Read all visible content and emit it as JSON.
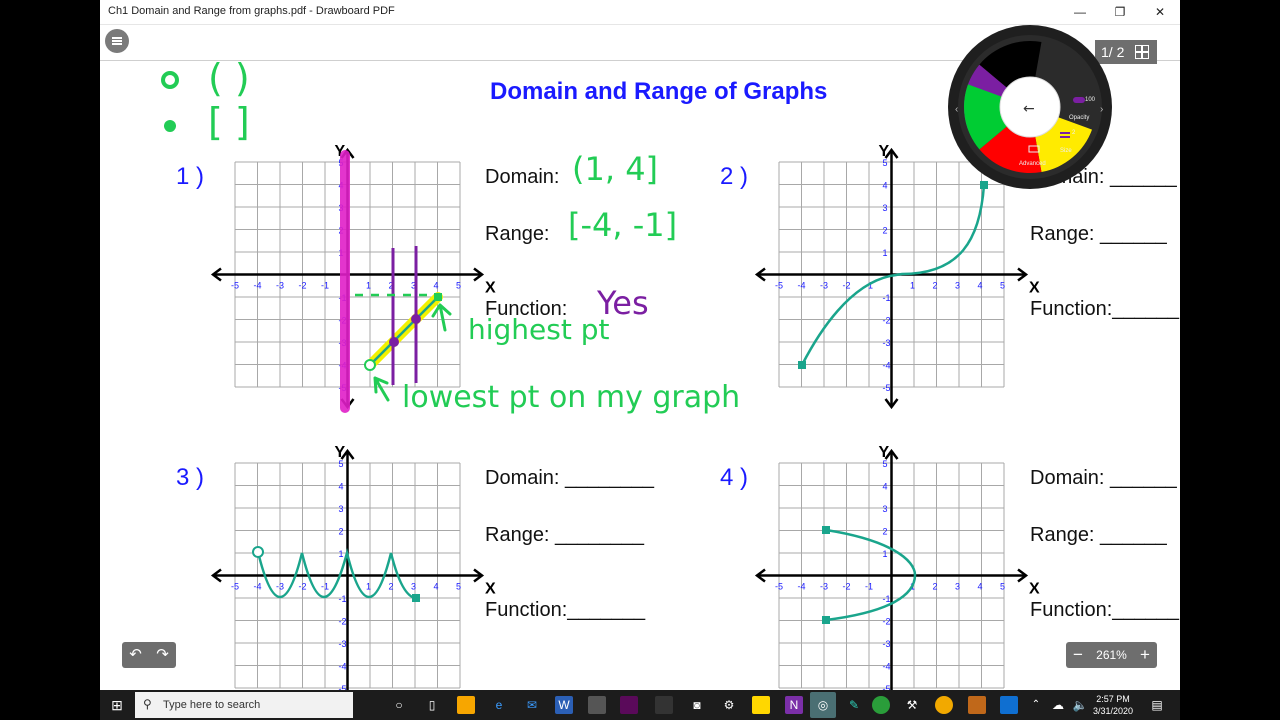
{
  "window": {
    "title": "Ch1 Domain and Range from graphs.pdf - Drawboard PDF",
    "minimize": "—",
    "maximize": "❐",
    "close": "✕"
  },
  "page_title": "Domain and Range of Graphs",
  "page_indicator": "1/ 2",
  "zoom": {
    "minus": "−",
    "value": "261%",
    "plus": "+"
  },
  "undo": "↶",
  "redo": "↷",
  "notes_legend": {
    "open": "( )",
    "closed": "[ ]"
  },
  "questions": [
    {
      "num": "1 )",
      "domain_label": "Domain:",
      "range_label": "Range:",
      "function_label": "Function:",
      "domain_answer": "(1, 4]",
      "range_answer": "[-4, -1]",
      "function_answer": "Yes"
    },
    {
      "num": "2 )",
      "domain_label": "Domain: ______",
      "range_label": "Range:   ______",
      "function_label": "Function:______"
    },
    {
      "num": "3 )",
      "domain_label": "Domain: ________",
      "range_label": "Range:   ________",
      "function_label": "Function:_______"
    },
    {
      "num": "4 )",
      "domain_label": "Domain: ______",
      "range_label": "Range:   ______",
      "function_label": "Function:______"
    }
  ],
  "annotations": {
    "highest": "highest pt",
    "lowest": "lowest pt on my graph"
  },
  "axes": {
    "x": "X",
    "y": "Y",
    "ticks": [
      "-5",
      "-4",
      "-3",
      "-2",
      "-1",
      "1",
      "2",
      "3",
      "4",
      "5"
    ]
  },
  "palette": {
    "colors": [
      "#7b1fa2",
      "#000000",
      "#ffeb00",
      "#ff0000",
      "#00cc33"
    ],
    "back": "←",
    "opacity_value": "100",
    "opacity_label": "Opacity",
    "size_value": "2",
    "size_label": "Size",
    "advanced_label": "Advanced"
  },
  "taskbar": {
    "search_placeholder": "Type here to search",
    "time": "2:57 PM",
    "date": "3/31/2020"
  }
}
